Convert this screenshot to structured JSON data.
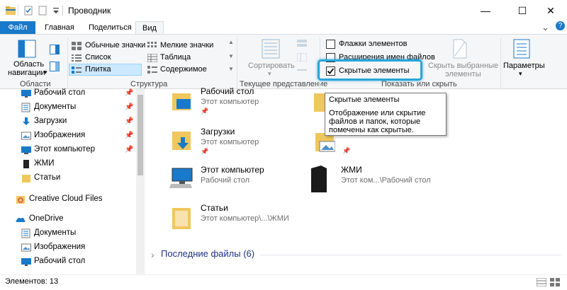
{
  "window": {
    "title": "Проводник",
    "minimize_glyph": "—",
    "maximize_glyph": "☐",
    "close_glyph": "✕",
    "chevron_glyph": "⌄",
    "help_glyph": "?"
  },
  "tabs": [
    {
      "label": "Файл",
      "active": false
    },
    {
      "label": "Главная",
      "active": false
    },
    {
      "label": "Поделиться",
      "active": false
    },
    {
      "label": "Вид",
      "active": true
    }
  ],
  "ribbon": {
    "panes": {
      "nav_area_line1": "Область",
      "nav_area_line2": "навигации",
      "dropdown_glyph": "▾",
      "group_label": "Области"
    },
    "layout": {
      "items": [
        "Обычные значки",
        "Список",
        "Плитка",
        "Мелкие значки",
        "Таблица",
        "Содержимое"
      ],
      "selected": "Плитка",
      "group_label": "Структура"
    },
    "current_view": {
      "sort_label": "Сортировать",
      "group_label": "Текущее представление"
    },
    "show_hide": {
      "checkboxes": [
        {
          "label": "Флажки элементов",
          "checked": false
        },
        {
          "label": "Расширения имен файлов",
          "checked": false
        },
        {
          "label": "Скрытые элементы",
          "checked": true
        }
      ],
      "hide_selected_line1": "Скрыть выбранные",
      "hide_selected_line2": "элементы",
      "group_label": "Показать или скрыть"
    },
    "options": {
      "label": "Параметры",
      "dropdown_glyph": "▾"
    }
  },
  "tooltip": {
    "title": "Скрытые элементы",
    "body_line1": "Отображение или скрытие",
    "body_line2": "файлов и папок, которые",
    "body_line3": "помечены как скрытые."
  },
  "nav": {
    "items": [
      {
        "label": "Рабочий стол",
        "icon": "desktop-icon",
        "pinned": true
      },
      {
        "label": "Документы",
        "icon": "documents-icon",
        "pinned": true
      },
      {
        "label": "Загрузки",
        "icon": "downloads-icon",
        "pinned": true
      },
      {
        "label": "Изображения",
        "icon": "pictures-icon",
        "pinned": true
      },
      {
        "label": "Этот компьютер",
        "icon": "computer-icon",
        "pinned": true
      },
      {
        "label": "ЖМИ",
        "icon": "folder-dark-icon",
        "pinned": false
      },
      {
        "label": "Статьи",
        "icon": "folder-icon",
        "pinned": false
      },
      {
        "label": "Creative Cloud Files",
        "icon": "creative-cloud-icon",
        "pinned": false
      },
      {
        "label": "OneDrive",
        "icon": "onedrive-icon",
        "pinned": false
      },
      {
        "label": "Документы",
        "icon": "documents-icon",
        "pinned": false
      },
      {
        "label": "Изображения",
        "icon": "pictures-icon",
        "pinned": false
      },
      {
        "label": "Рабочий стол",
        "icon": "desktop-icon",
        "pinned": false
      }
    ],
    "pin_glyph": "📌"
  },
  "content": {
    "tiles": [
      {
        "title": "Рабочий стол",
        "sub": "Этот компьютер"
      },
      {
        "title": "Загрузки",
        "sub": "Этот компьютер"
      },
      {
        "title": "Этот компьютер",
        "sub": "Рабочий стол"
      },
      {
        "title": "Статьи",
        "sub": "Этот компьютер\\...\\ЖМИ"
      },
      {
        "title": "ЖМИ",
        "sub": "Этот ком...\\Рабочий стол"
      }
    ],
    "recent_section": "Последние файлы (6)",
    "expand_glyph": "›"
  },
  "status": {
    "items_count": "Элементов: 13"
  },
  "colors": {
    "accent": "#1979ca",
    "highlight": "#29a5d8",
    "folder": "#f0c75e"
  }
}
